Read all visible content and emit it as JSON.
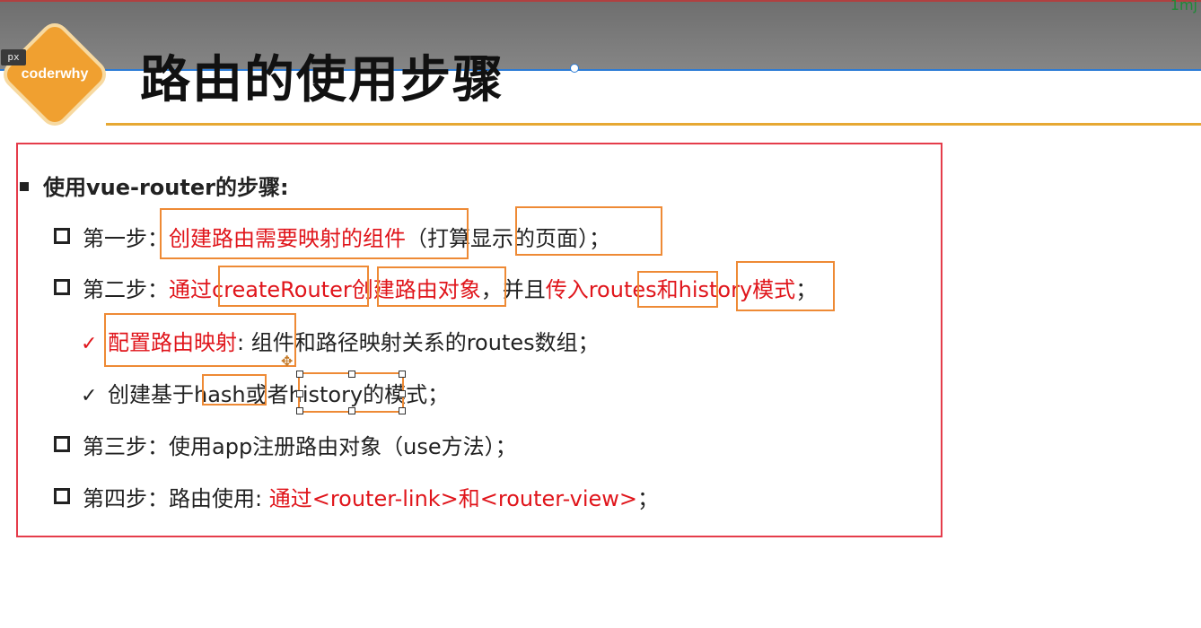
{
  "topbar": {
    "corner_text": "1mj"
  },
  "px_tag": "px",
  "logo": {
    "text": "coderwhy"
  },
  "title": "路由的使用步骤",
  "content": {
    "heading": "使用vue-router的步骤:",
    "step1": {
      "label": "第一步：",
      "red": "创建路由需要映射的组件",
      "rest": "（打算显示的页面）；"
    },
    "step2": {
      "label": "第二步：",
      "red1": "通过createRouter创建路由对象",
      "mid": "，并且",
      "red2": "传入routes和history模式",
      "end": "；"
    },
    "sub1": {
      "check": "✓",
      "red": "配置路由映射",
      "rest": ": 组件和路径映射关系的routes数组；"
    },
    "sub2": {
      "check": "✓",
      "text": "创建基于hash或者history的模式；"
    },
    "step3": {
      "label": "第三步：",
      "text": "使用app注册路由对象（use方法）；"
    },
    "step4": {
      "label": "第四步：",
      "text": "路由使用: ",
      "red": "通过<router-link>和<router-view>",
      "end": "；"
    }
  },
  "colors": {
    "accent_red": "#e0151b",
    "highlight_orange": "#ee8a35",
    "border_red": "#e53c4b",
    "logo_orange": "#f0a030"
  }
}
